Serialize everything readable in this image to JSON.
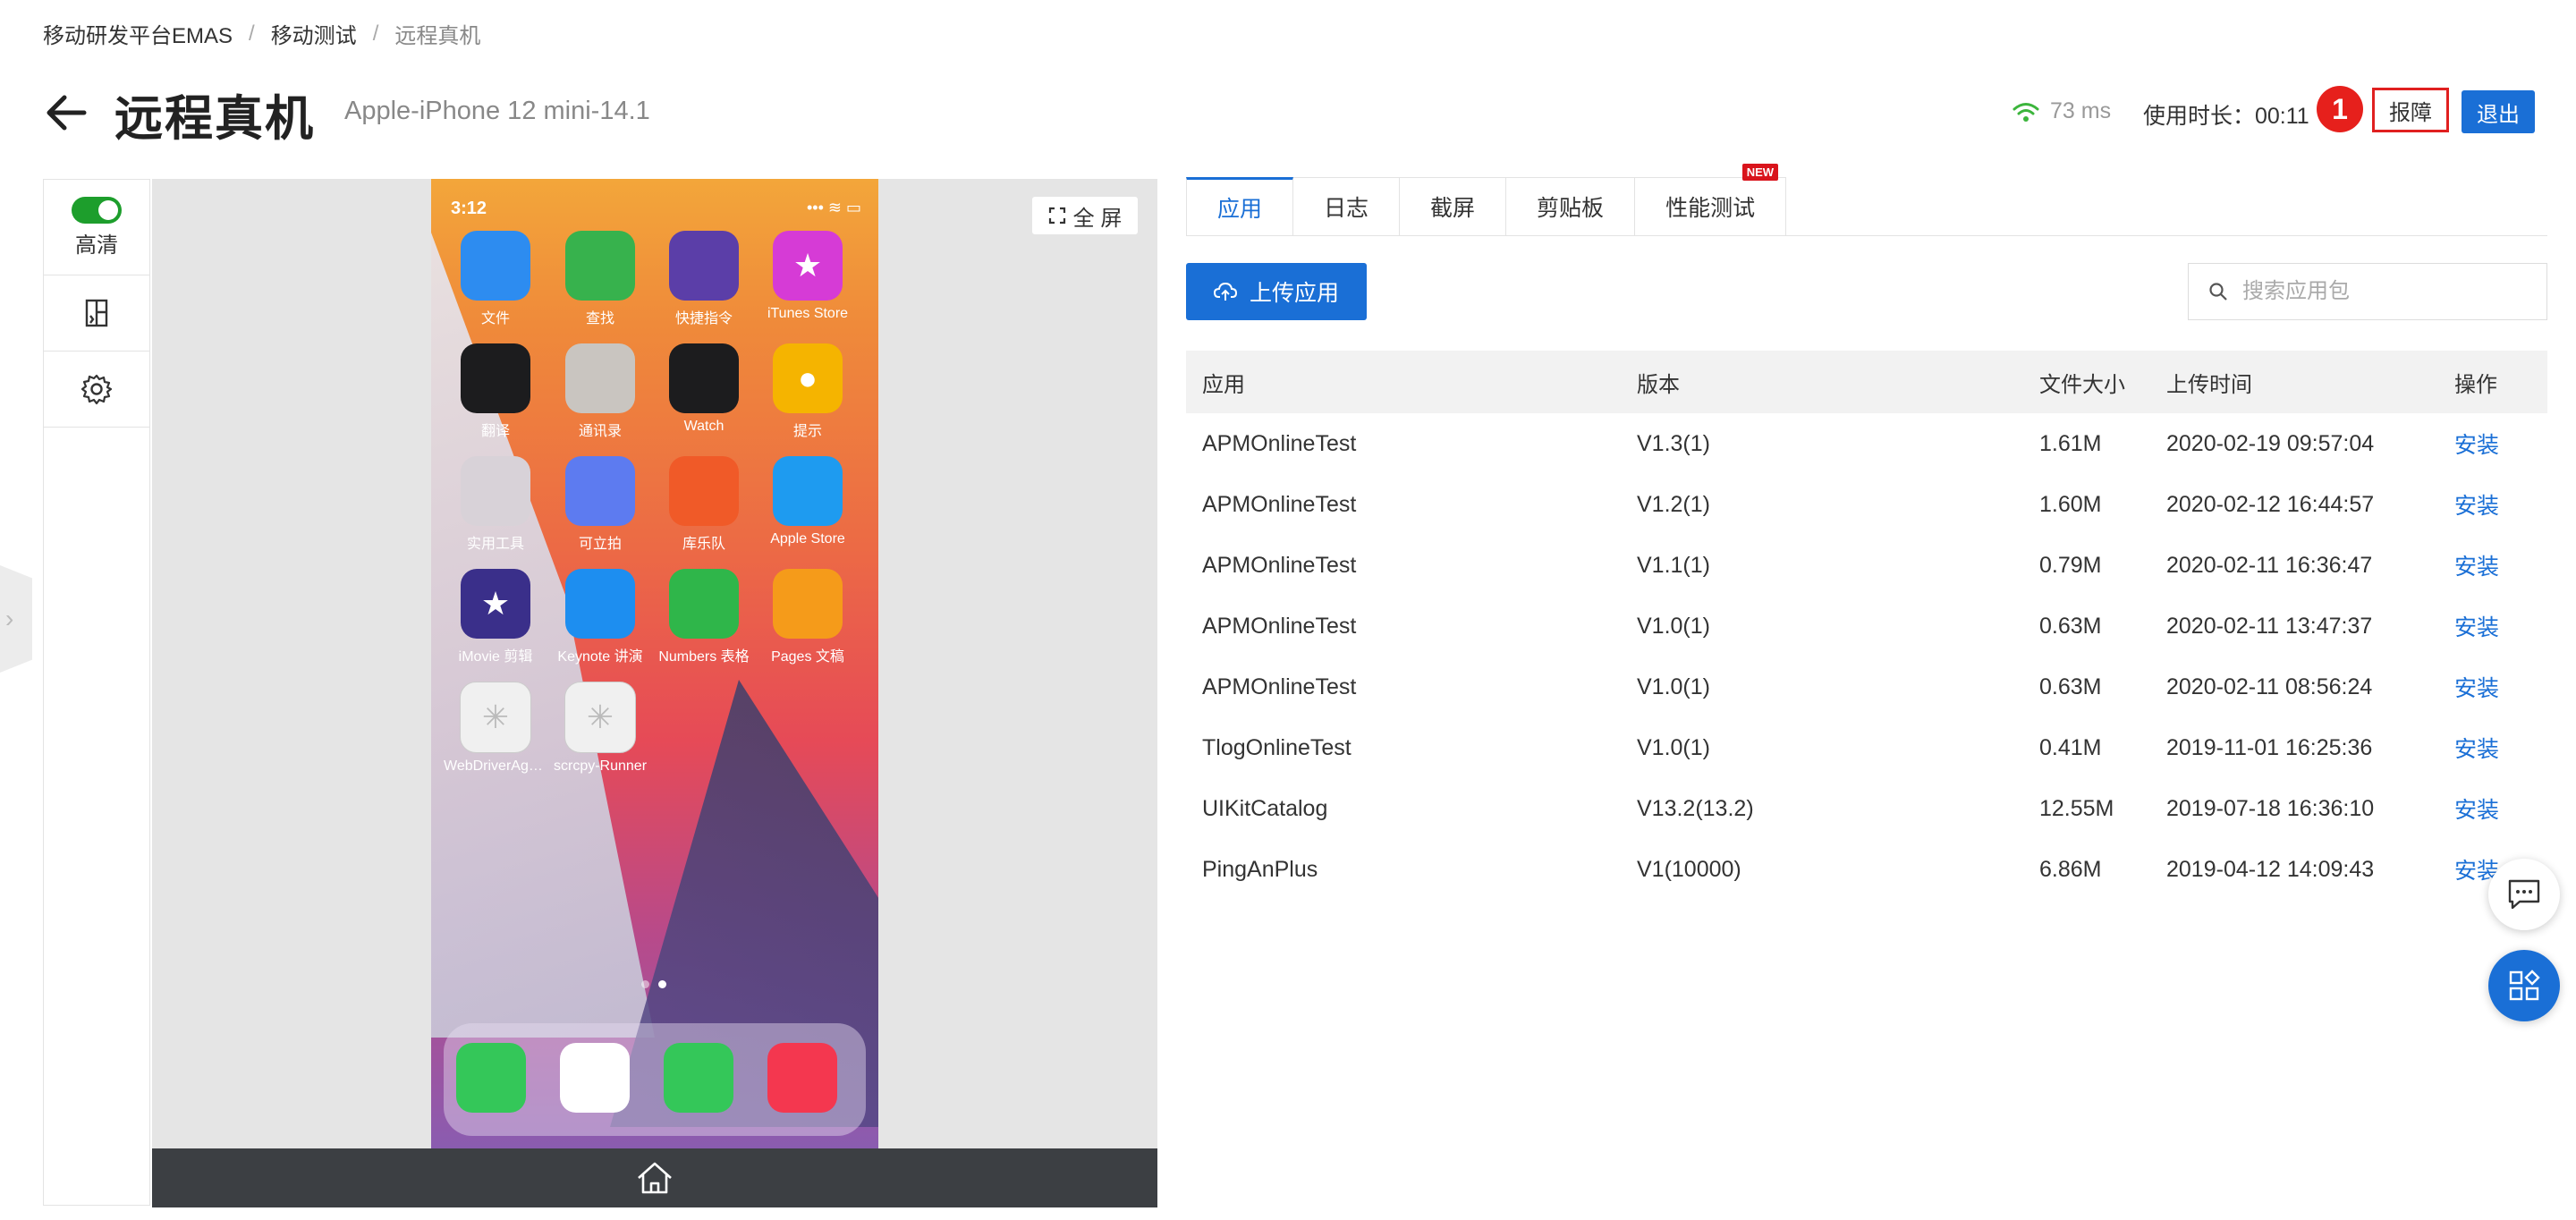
{
  "breadcrumb": {
    "root": "移动研发平台EMAS",
    "parent": "移动测试",
    "current": "远程真机"
  },
  "header": {
    "title": "远程真机",
    "device": "Apple-iPhone 12 mini-14.1",
    "latency": "73 ms",
    "usage": "使用时长：00:11",
    "badge": "1",
    "report_label": "报障",
    "exit_label": "退出"
  },
  "toolbar": {
    "hd_label": "高清",
    "hd_on": true
  },
  "device_view": {
    "fullscreen_label": "全 屏",
    "status_time": "3:12",
    "apps": [
      {
        "label": "文件",
        "icon": "files-icon",
        "color": "#2d8cf0"
      },
      {
        "label": "查找",
        "icon": "find-my-icon",
        "color": "#37b24d"
      },
      {
        "label": "快捷指令",
        "icon": "shortcuts-icon",
        "color": "#5b3ea8"
      },
      {
        "label": "iTunes Store",
        "icon": "itunes-star-icon",
        "color": "#d63bd6"
      },
      {
        "label": "翻译",
        "icon": "translate-icon",
        "color": "#1c1c1e"
      },
      {
        "label": "通讯录",
        "icon": "contacts-icon",
        "color": "#c9c5c0"
      },
      {
        "label": "Watch",
        "icon": "watch-icon",
        "color": "#1c1c1e"
      },
      {
        "label": "提示",
        "icon": "tips-bulb-icon",
        "color": "#f5b400"
      },
      {
        "label": "实用工具",
        "icon": "utilities-folder-icon",
        "color": "#d8d2d8"
      },
      {
        "label": "可立拍",
        "icon": "clips-icon",
        "color": "#5d7bf0"
      },
      {
        "label": "库乐队",
        "icon": "garageband-icon",
        "color": "#f05a28"
      },
      {
        "label": "Apple Store",
        "icon": "apple-store-bag-icon",
        "color": "#1e9bf0"
      },
      {
        "label": "iMovie 剪辑",
        "icon": "imovie-star-icon",
        "color": "#3a2f8a"
      },
      {
        "label": "Keynote 讲演",
        "icon": "keynote-icon",
        "color": "#1d8ef0"
      },
      {
        "label": "Numbers 表格",
        "icon": "numbers-chart-icon",
        "color": "#2fb64a"
      },
      {
        "label": "Pages 文稿",
        "icon": "pages-pen-icon",
        "color": "#f59b1a"
      },
      {
        "label": "WebDriverAge...",
        "icon": "placeholder-grid-icon",
        "color": "#f0f0f0"
      },
      {
        "label": "scrcpy-Runner",
        "icon": "placeholder-grid-icon",
        "color": "#f0f0f0"
      }
    ],
    "dock": [
      {
        "icon": "phone-icon",
        "color": "#34c759"
      },
      {
        "icon": "safari-compass-icon",
        "color": "#ffffff"
      },
      {
        "icon": "messages-icon",
        "color": "#34c759"
      },
      {
        "icon": "music-note-icon",
        "color": "#f4374f"
      }
    ]
  },
  "tabs": [
    {
      "label": "应用",
      "active": true
    },
    {
      "label": "日志"
    },
    {
      "label": "截屏"
    },
    {
      "label": "剪贴板"
    },
    {
      "label": "性能测试",
      "badge": "NEW"
    }
  ],
  "upload_label": "上传应用",
  "search": {
    "placeholder": "搜索应用包",
    "value": ""
  },
  "table": {
    "headers": [
      "应用",
      "版本",
      "文件大小",
      "上传时间",
      "操作"
    ],
    "rows": [
      {
        "app": "APMOnlineTest",
        "version": "V1.3(1)",
        "size": "1.61M",
        "time": "2020-02-19 09:57:04",
        "action": "安装"
      },
      {
        "app": "APMOnlineTest",
        "version": "V1.2(1)",
        "size": "1.60M",
        "time": "2020-02-12 16:44:57",
        "action": "安装"
      },
      {
        "app": "APMOnlineTest",
        "version": "V1.1(1)",
        "size": "0.79M",
        "time": "2020-02-11 16:36:47",
        "action": "安装"
      },
      {
        "app": "APMOnlineTest",
        "version": "V1.0(1)",
        "size": "0.63M",
        "time": "2020-02-11 13:47:37",
        "action": "安装"
      },
      {
        "app": "APMOnlineTest",
        "version": "V1.0(1)",
        "size": "0.63M",
        "time": "2020-02-11 08:56:24",
        "action": "安装"
      },
      {
        "app": "TlogOnlineTest",
        "version": "V1.0(1)",
        "size": "0.41M",
        "time": "2019-11-01 16:25:36",
        "action": "安装"
      },
      {
        "app": "UIKitCatalog",
        "version": "V13.2(13.2)",
        "size": "12.55M",
        "time": "2019-07-18 16:36:10",
        "action": "安装"
      },
      {
        "app": "PingAnPlus",
        "version": "V1(10000)",
        "size": "6.86M",
        "time": "2019-04-12 14:09:43",
        "action": "安装"
      }
    ]
  },
  "colors": {
    "primary": "#1a6fd6",
    "danger": "#e02020",
    "toggle_on": "#1d9e2c"
  }
}
